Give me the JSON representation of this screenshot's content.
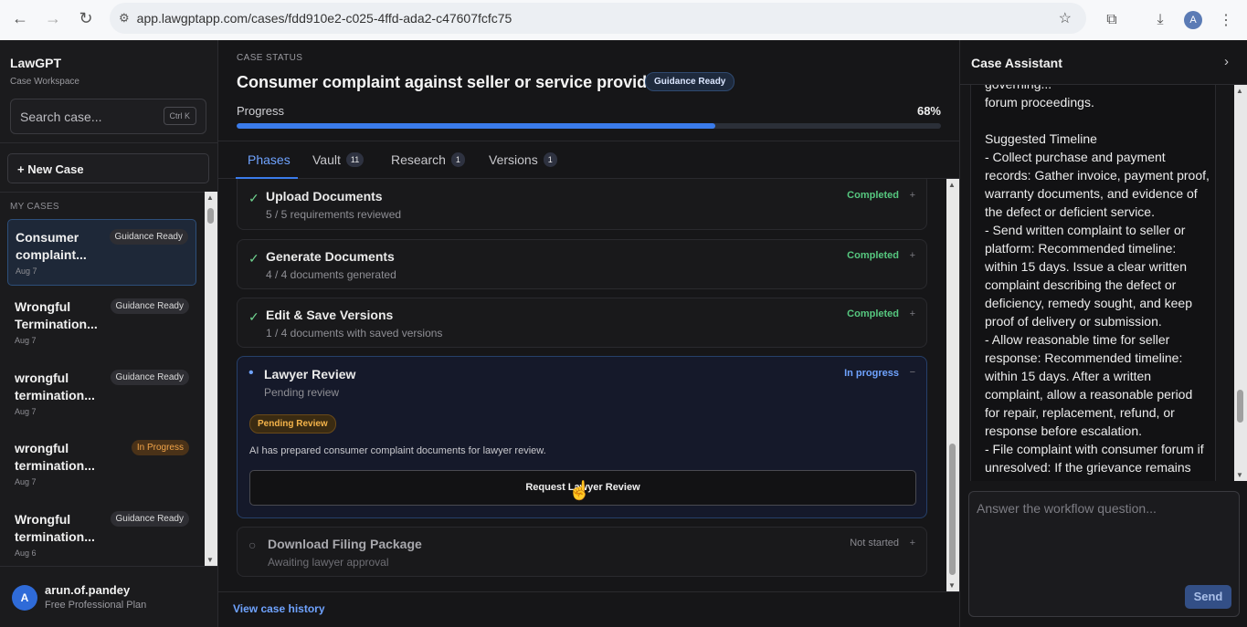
{
  "browser": {
    "url": "app.lawgptapp.com/cases/fdd910e2-c025-4ffd-ada2-c47607fcfc75",
    "profile_initial": "A"
  },
  "sidebar": {
    "brand": "LawGPT",
    "brand_sub": "Case Workspace",
    "search_placeholder": "Search case...",
    "search_shortcut": "Ctrl K",
    "new_case": "+ New Case",
    "section_label": "MY CASES",
    "cases": [
      {
        "title": "Consumer complaint...",
        "badge": "Guidance Ready",
        "date": "Aug 7"
      },
      {
        "title": "Wrongful Termination...",
        "badge": "Guidance Ready",
        "date": "Aug 7"
      },
      {
        "title": "wrongful termination...",
        "badge": "Guidance Ready",
        "date": "Aug 7"
      },
      {
        "title": "wrongful termination...",
        "badge": "In Progress",
        "date": "Aug 7"
      },
      {
        "title": "Wrongful termination...",
        "badge": "Guidance Ready",
        "date": "Aug 6"
      }
    ],
    "user": {
      "initial": "A",
      "name": "arun.of.pandey",
      "plan": "Free Professional Plan"
    }
  },
  "main": {
    "status_label": "CASE STATUS",
    "title": "Consumer complaint against seller or service provider",
    "status_badge": "Guidance Ready",
    "progress_label": "Progress",
    "progress_text": "68%",
    "progress_value": 0.68,
    "tabs": [
      {
        "label": "Phases",
        "count": ""
      },
      {
        "label": "Vault",
        "count": "11"
      },
      {
        "label": "Research",
        "count": "1"
      },
      {
        "label": "Versions",
        "count": "1"
      }
    ],
    "phases": [
      {
        "title": "Upload Documents",
        "sub": "5 / 5 requirements reviewed",
        "status": "Completed",
        "icon": "✓",
        "toggle": "+"
      },
      {
        "title": "Generate Documents",
        "sub": "4 / 4 documents generated",
        "status": "Completed",
        "icon": "✓",
        "toggle": "+"
      },
      {
        "title": "Edit & Save Versions",
        "sub": "1 / 4 documents with saved versions",
        "status": "Completed",
        "icon": "✓",
        "toggle": "+"
      },
      {
        "title": "Lawyer Review",
        "sub": "Pending review",
        "status": "In progress",
        "icon": "•",
        "toggle": "−",
        "pending_badge": "Pending Review",
        "description": "AI has prepared consumer complaint documents for lawyer review.",
        "action": "Request Lawyer Review"
      },
      {
        "title": "Download Filing Package",
        "sub": "Awaiting lawyer approval",
        "status": "Not started",
        "icon": "○",
        "toggle": "+"
      }
    ],
    "history_link": "View case history"
  },
  "assistant": {
    "title": "Case Assistant",
    "message": "governing...\nforum proceedings.\n\nSuggested Timeline\n- Collect purchase and payment records: Gather invoice, payment proof, warranty documents, and evidence of the defect or deficient service.\n- Send written complaint to seller or platform: Recommended timeline: within 15 days. Issue a clear written complaint describing the defect or deficiency, remedy sought, and keep proof of delivery or submission.\n- Allow reasonable time for seller response: Recommended timeline: within 15 days. After a written complaint, allow a reasonable period for repair, replacement, refund, or response before escalation.\n- File complaint with consumer forum if unresolved: If the grievance remains",
    "input_placeholder": "Answer the workflow question...",
    "send": "Send"
  },
  "colors": {
    "accent": "#3a7bea",
    "completed": "#56c77f",
    "in_progress": "#6fa3ff",
    "warning": "#f5b44a"
  }
}
